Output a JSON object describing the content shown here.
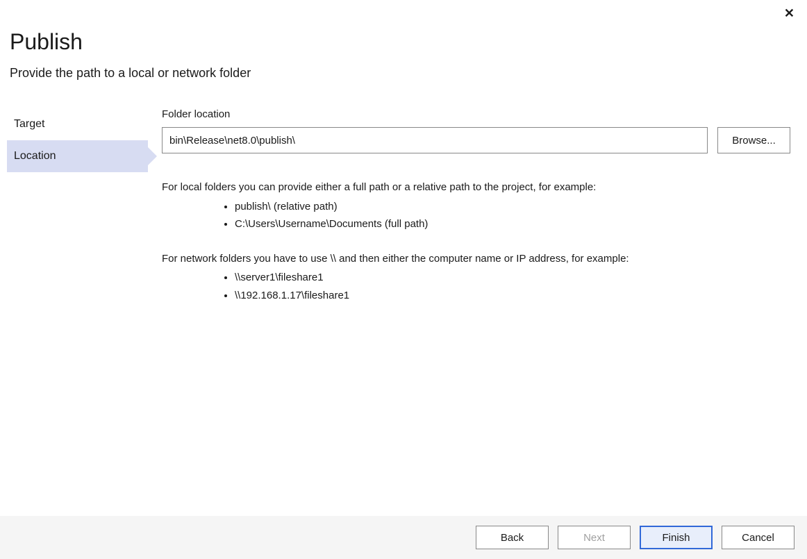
{
  "title": "Publish",
  "subtitle": "Provide the path to a local or network folder",
  "closeLabel": "✕",
  "sidebar": {
    "items": [
      {
        "label": "Target",
        "active": false
      },
      {
        "label": "Location",
        "active": true
      }
    ]
  },
  "form": {
    "folderLabel": "Folder location",
    "folderValue": "bin\\Release\\net8.0\\publish\\",
    "browseLabel": "Browse..."
  },
  "help": {
    "localIntro": "For local folders you can provide either a full path or a relative path to the project, for example:",
    "localExamples": [
      "publish\\ (relative path)",
      "C:\\Users\\Username\\Documents (full path)"
    ],
    "networkIntro": "For network folders you have to use \\\\ and then either the computer name or IP address, for example:",
    "networkExamples": [
      "\\\\server1\\fileshare1",
      "\\\\192.168.1.17\\fileshare1"
    ]
  },
  "footer": {
    "back": "Back",
    "next": "Next",
    "finish": "Finish",
    "cancel": "Cancel"
  }
}
